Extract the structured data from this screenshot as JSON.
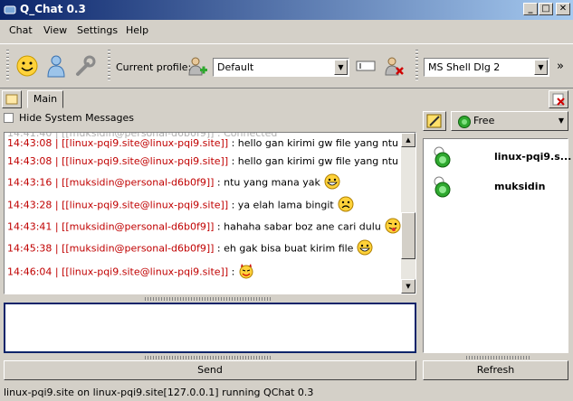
{
  "window": {
    "title": "Q_Chat 0.3"
  },
  "menu": [
    "Chat",
    "View",
    "Settings",
    "Help"
  ],
  "toolbar": {
    "profile_label": "Current profile:",
    "profile_value": "Default",
    "font_value": "MS Shell Dlg 2",
    "overflow": "»"
  },
  "tabs": [
    {
      "label": "Main"
    }
  ],
  "hide_system": {
    "label": "Hide System Messages",
    "checked": false
  },
  "messages": [
    {
      "meta": "14:43:08 | [[linux-pqi9.site@linux-pqi9.site]]",
      "text": " : hello gan kirimi gw file  yang ntu",
      "smiley": ""
    },
    {
      "meta": "14:43:08 | [[linux-pqi9.site@linux-pqi9.site]]",
      "text": " : hello gan kirimi gw file  yang ntu",
      "smiley": ""
    },
    {
      "meta": "14:43:16 | [[muksidin@personal-d6b0f9]]",
      "text": " : ntu yang mana yak",
      "smiley": "grin"
    },
    {
      "meta": "14:43:28 | [[linux-pqi9.site@linux-pqi9.site]]",
      "text": " : ya elah lama bingit",
      "smiley": "sad"
    },
    {
      "meta": "14:43:41 | [[muksidin@personal-d6b0f9]]",
      "text": " : hahaha sabar boz ane cari dulu",
      "smiley": "tongue"
    },
    {
      "meta": "14:45:38 | [[muksidin@personal-d6b0f9]]",
      "text": " : eh gak bisa buat kirim file",
      "smiley": "grin"
    },
    {
      "meta": "14:46:04 | [[linux-pqi9.site@linux-pqi9.site]]",
      "text": " :",
      "smiley": "devil"
    }
  ],
  "buttons": {
    "send": "Send",
    "refresh": "Refresh"
  },
  "status": {
    "value": "Free"
  },
  "users": [
    {
      "name": "linux-pqi9.s..."
    },
    {
      "name": "muksidin"
    }
  ],
  "statusbar": "linux-pqi9.site on linux-pqi9.site[127.0.0.1] running QChat 0.3",
  "colors": {
    "title_start": "#0a246a",
    "title_end": "#a6caf0",
    "meta": "#c00000",
    "status_green": "#2fa82f"
  }
}
